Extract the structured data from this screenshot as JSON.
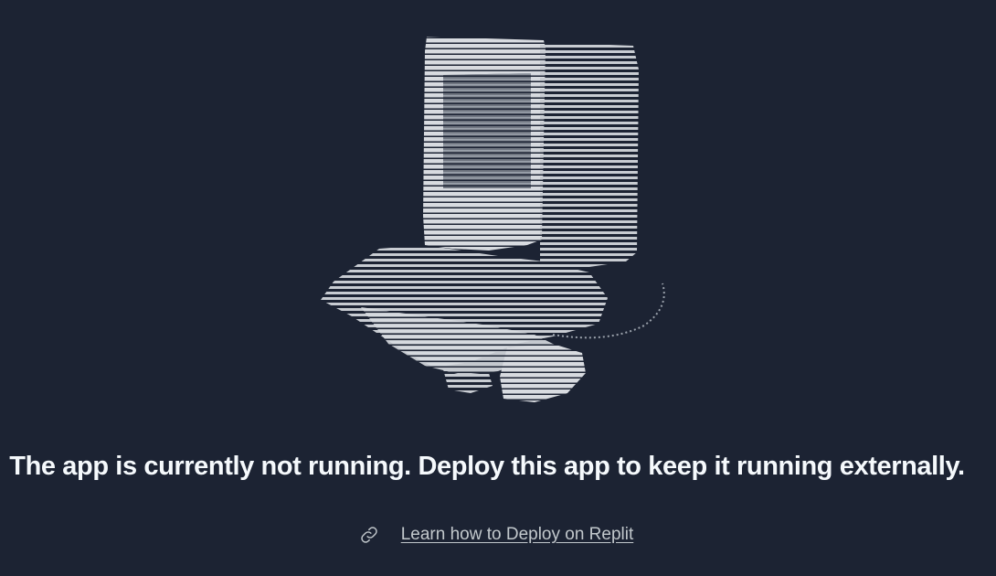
{
  "page": {
    "background_color": "#1c2333",
    "text_color": "#f5f9fc",
    "link_color": "#c2c8cc"
  },
  "illustration": {
    "icon": "ascii-boot-illustration"
  },
  "message": {
    "headline": "The app is currently not running. Deploy this app to keep it running externally."
  },
  "help_link": {
    "icon": "link-icon",
    "label": "Learn how to Deploy on Replit"
  }
}
